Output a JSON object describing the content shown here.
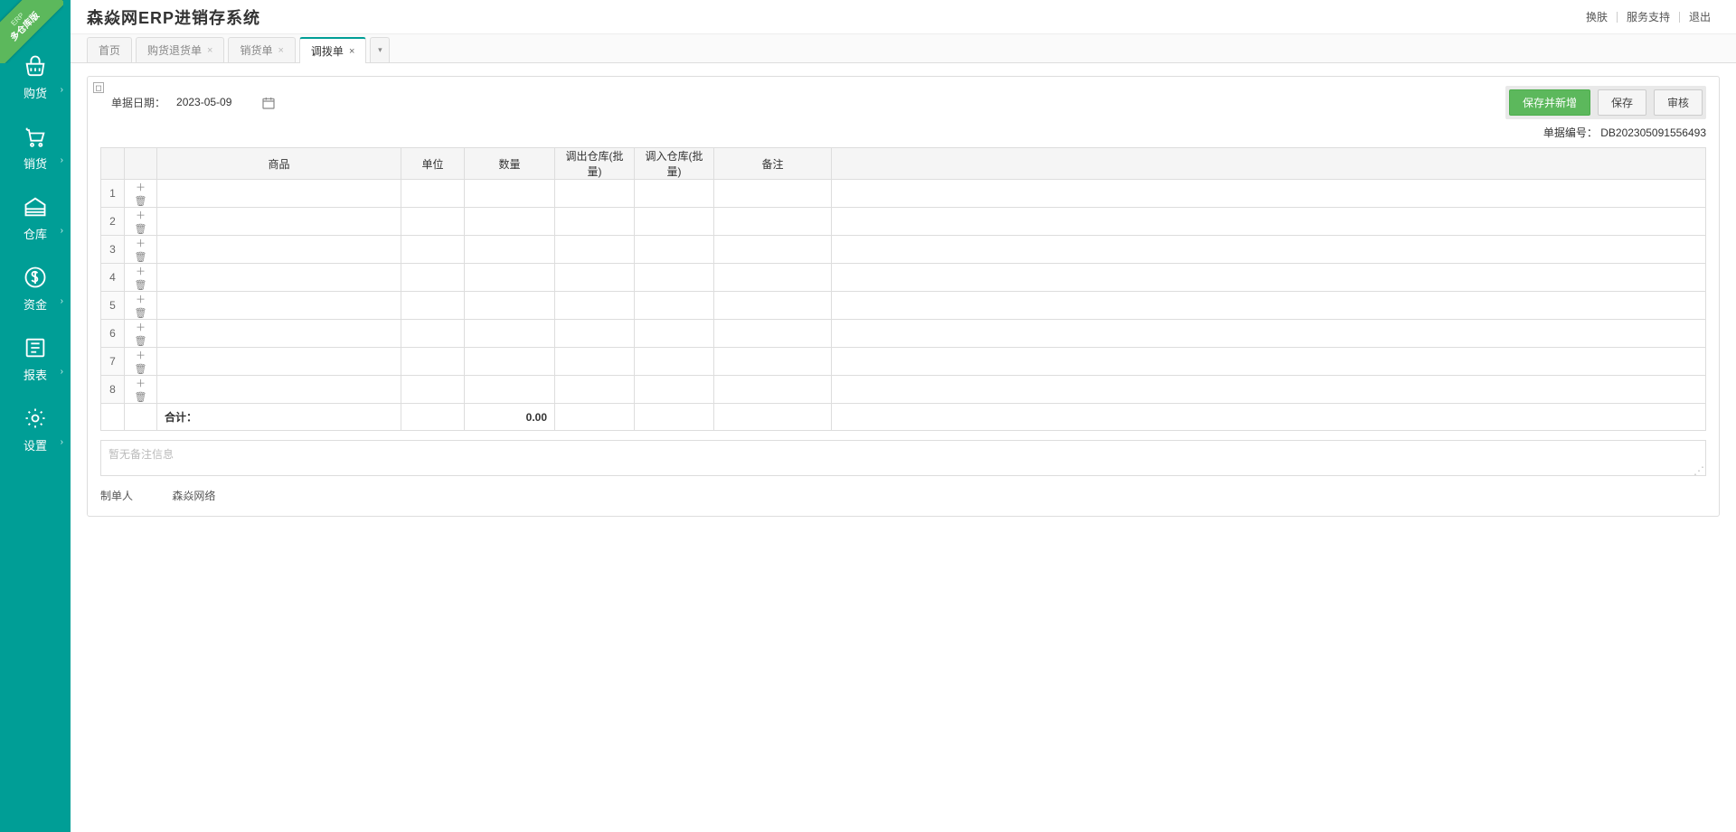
{
  "badge": {
    "line1": "ERP",
    "line2": "多仓库版"
  },
  "sidebar": {
    "items": [
      {
        "label": "购货",
        "icon": "basket"
      },
      {
        "label": "销货",
        "icon": "cart"
      },
      {
        "label": "仓库",
        "icon": "warehouse"
      },
      {
        "label": "资金",
        "icon": "money"
      },
      {
        "label": "报表",
        "icon": "report"
      },
      {
        "label": "设置",
        "icon": "gear"
      }
    ]
  },
  "header": {
    "title": "森焱网ERP进销存系统",
    "links": [
      "换肤",
      "服务支持",
      "退出"
    ]
  },
  "tabs": [
    {
      "label": "首页",
      "closable": false,
      "active": false
    },
    {
      "label": "购货退货单",
      "closable": true,
      "active": false
    },
    {
      "label": "销货单",
      "closable": true,
      "active": false
    },
    {
      "label": "调拨单",
      "closable": true,
      "active": true
    }
  ],
  "form": {
    "date_label": "单据日期：",
    "date_value": "2023-05-09",
    "buttons": {
      "save_new": "保存并新增",
      "save": "保存",
      "audit": "审核"
    },
    "doc_no_label": "单据编号：",
    "doc_no": "DB202305091556493"
  },
  "table": {
    "columns": [
      "",
      "",
      "商品",
      "单位",
      "数量",
      "调出仓库(批量)",
      "调入仓库(批量)",
      "备注",
      ""
    ],
    "row_count": 8,
    "total_label": "合计：",
    "total_qty": "0.00"
  },
  "remark": {
    "placeholder": "暂无备注信息"
  },
  "footer": {
    "creator_label": "制单人",
    "creator": "森焱网络"
  }
}
